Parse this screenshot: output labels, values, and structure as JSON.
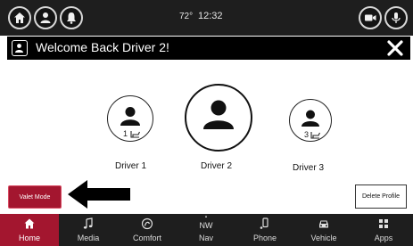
{
  "status": {
    "temperature": "72°",
    "time": "12:32",
    "left_buttons": [
      "home-icon",
      "profile-icon",
      "notification-bell-icon"
    ],
    "right_buttons": [
      "camera-icon",
      "microphone-icon"
    ]
  },
  "profile_header": {
    "title": "Welcome Back Driver 2!",
    "close_icon": "close-icon"
  },
  "drivers": [
    {
      "label": "Driver 1",
      "seat": "1",
      "selected": false
    },
    {
      "label": "Driver 2",
      "seat": "",
      "selected": true
    },
    {
      "label": "Driver 3",
      "seat": "3",
      "selected": false
    }
  ],
  "buttons": {
    "valet_mode": "Valet Mode",
    "delete_profile": "Delete Profile"
  },
  "nav": {
    "items": [
      {
        "label": "Home",
        "icon": "home-icon",
        "active": true
      },
      {
        "label": "Media",
        "icon": "music-note-icon",
        "active": false
      },
      {
        "label": "Comfort",
        "icon": "comfort-icon",
        "active": false
      },
      {
        "label": "Nav",
        "icon": "compass-icon",
        "active": false,
        "heading": "NW"
      },
      {
        "label": "Phone",
        "icon": "phone-icon",
        "active": false
      },
      {
        "label": "Vehicle",
        "icon": "car-icon",
        "active": false
      },
      {
        "label": "Apps",
        "icon": "apps-grid-icon",
        "active": false
      }
    ]
  },
  "colors": {
    "accent": "#a3162f",
    "bar_background": "#1e1e1e",
    "header_background": "#000000"
  }
}
